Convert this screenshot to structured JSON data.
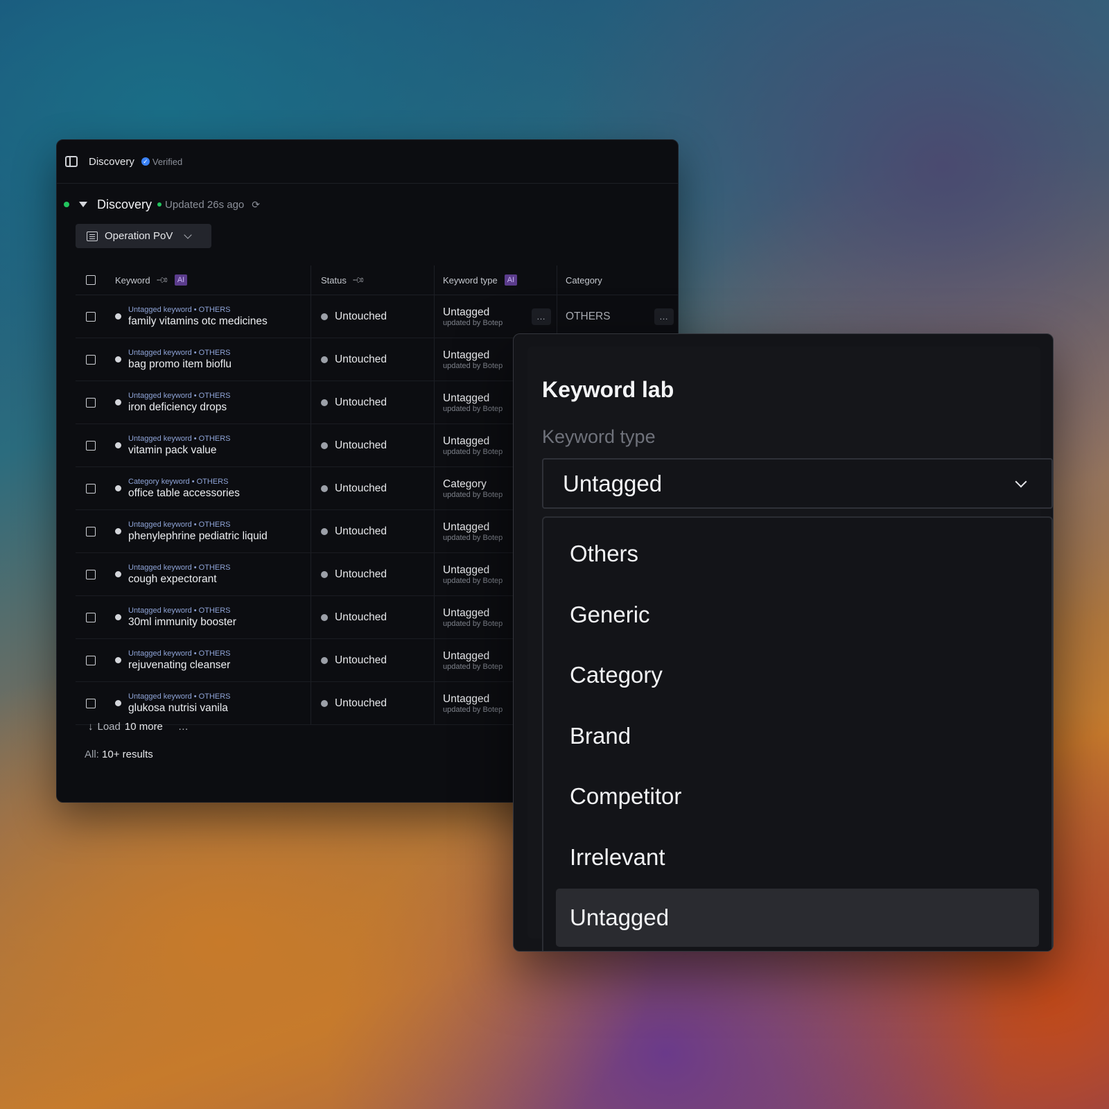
{
  "topbar": {
    "title": "Discovery",
    "verified_label": "Verified"
  },
  "section": {
    "title": "Discovery",
    "updated": "Updated 26s ago"
  },
  "view_selector": {
    "label": "Operation PoV"
  },
  "table": {
    "headers": {
      "keyword": "Keyword",
      "keyword_ai": "AI",
      "status": "Status",
      "keyword_type": "Keyword type",
      "keyword_type_ai": "AI",
      "category": "Category"
    },
    "rows": [
      {
        "meta": "Untagged keyword • OTHERS",
        "keyword": "family vitamins otc medicines",
        "status": "Untouched",
        "type": "Untagged",
        "updated_by": "updated by Botep",
        "category": "OTHERS"
      },
      {
        "meta": "Untagged keyword • OTHERS",
        "keyword": "bag promo item bioflu",
        "status": "Untouched",
        "type": "Untagged",
        "updated_by": "updated by Botep"
      },
      {
        "meta": "Untagged keyword • OTHERS",
        "keyword": "iron deficiency drops",
        "status": "Untouched",
        "type": "Untagged",
        "updated_by": "updated by Botep"
      },
      {
        "meta": "Untagged keyword • OTHERS",
        "keyword": "vitamin pack value",
        "status": "Untouched",
        "type": "Untagged",
        "updated_by": "updated by Botep"
      },
      {
        "meta": "Category keyword • OTHERS",
        "keyword": "office table accessories",
        "status": "Untouched",
        "type": "Category",
        "updated_by": "updated by Botep"
      },
      {
        "meta": "Untagged keyword • OTHERS",
        "keyword": "phenylephrine pediatric liquid",
        "status": "Untouched",
        "type": "Untagged",
        "updated_by": "updated by Botep"
      },
      {
        "meta": "Untagged keyword • OTHERS",
        "keyword": "cough expectorant",
        "status": "Untouched",
        "type": "Untagged",
        "updated_by": "updated by Botep"
      },
      {
        "meta": "Untagged keyword • OTHERS",
        "keyword": "30ml immunity booster",
        "status": "Untouched",
        "type": "Untagged",
        "updated_by": "updated by Botep"
      },
      {
        "meta": "Untagged keyword • OTHERS",
        "keyword": "rejuvenating cleanser",
        "status": "Untouched",
        "type": "Untagged",
        "updated_by": "updated by Botep"
      },
      {
        "meta": "Untagged keyword • OTHERS",
        "keyword": "glukosa nutrisi vanila",
        "status": "Untouched",
        "type": "Untagged",
        "updated_by": "updated by Botep"
      }
    ],
    "more_icon": "…"
  },
  "footer": {
    "load_prefix": "Load",
    "load_count": "10 more",
    "results_prefix": "All:",
    "results_value": "10+ results"
  },
  "panel": {
    "title": "Keyword lab",
    "field_label": "Keyword type",
    "selected_value": "Untagged",
    "options": [
      "Others",
      "Generic",
      "Category",
      "Brand",
      "Competitor",
      "Irrelevant",
      "Untagged"
    ]
  }
}
